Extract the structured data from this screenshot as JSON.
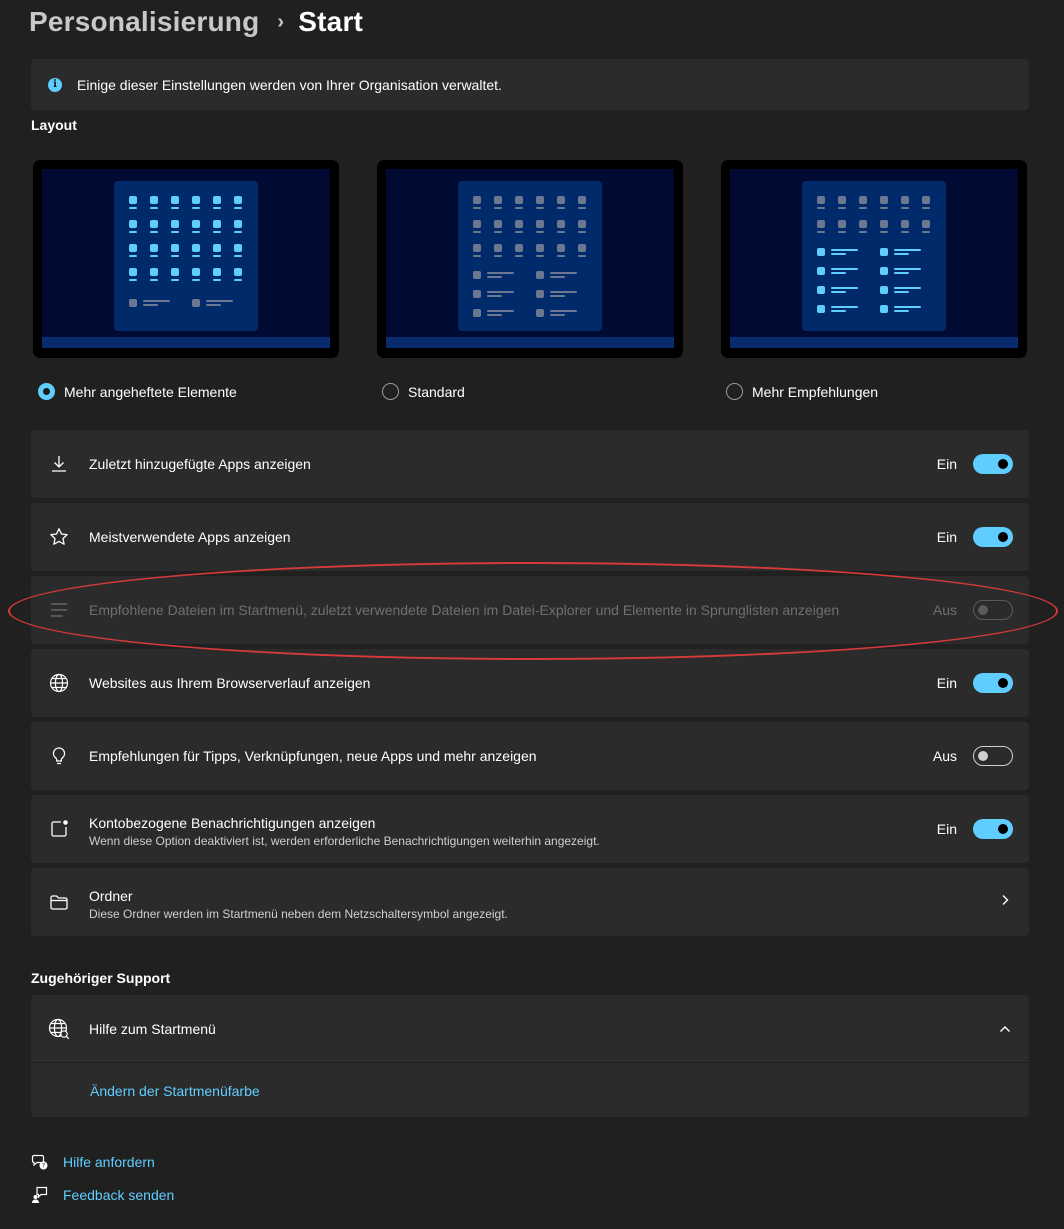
{
  "header": {
    "breadcrumb_parent": "Personalisierung",
    "separator": "›",
    "current": "Start"
  },
  "info_banner": {
    "text": "Einige dieser Einstellungen werden von Ihrer Organisation verwaltet."
  },
  "layout": {
    "section_label": "Layout",
    "options": [
      {
        "label": "Mehr angeheftete Elemente",
        "selected": true
      },
      {
        "label": "Standard",
        "selected": false
      },
      {
        "label": "Mehr Empfehlungen",
        "selected": false
      }
    ]
  },
  "settings": [
    {
      "icon": "download-icon",
      "label": "Zuletzt hinzugefügte Apps anzeigen",
      "state": "Ein",
      "on": true
    },
    {
      "icon": "star-icon",
      "label": "Meistverwendete Apps anzeigen",
      "state": "Ein",
      "on": true
    },
    {
      "icon": "list-icon",
      "label": "Empfohlene Dateien im Startmenü, zuletzt verwendete Dateien im Datei-Explorer und Elemente in Sprunglisten anzeigen",
      "state": "Aus",
      "on": false,
      "disabled": true
    },
    {
      "icon": "globe-icon",
      "label": "Websites aus Ihrem Browserverlauf anzeigen",
      "state": "Ein",
      "on": true
    },
    {
      "icon": "lightbulb-icon",
      "label": "Empfehlungen für Tipps, Verknüpfungen, neue Apps und mehr anzeigen",
      "state": "Aus",
      "on": false
    },
    {
      "icon": "notification-icon",
      "label": "Kontobezogene Benachrichtigungen anzeigen",
      "sublabel": "Wenn diese Option deaktiviert ist, werden erforderliche Benachrichtigungen weiterhin angezeigt.",
      "state": "Ein",
      "on": true
    },
    {
      "icon": "folder-icon",
      "label": "Ordner",
      "sublabel": "Diese Ordner werden im Startmenü neben dem Netzschaltersymbol angezeigt."
    }
  ],
  "support": {
    "section_label": "Zugehöriger Support",
    "help_title": "Hilfe zum Startmenü",
    "help_link": "Ändern der Startmenüfarbe"
  },
  "footer": {
    "get_help": "Hilfe anfordern",
    "feedback": "Feedback senden"
  },
  "colors": {
    "accent": "#60cdff",
    "background": "#202020",
    "card": "#2b2b2b",
    "annotation": "#d83a3a"
  }
}
